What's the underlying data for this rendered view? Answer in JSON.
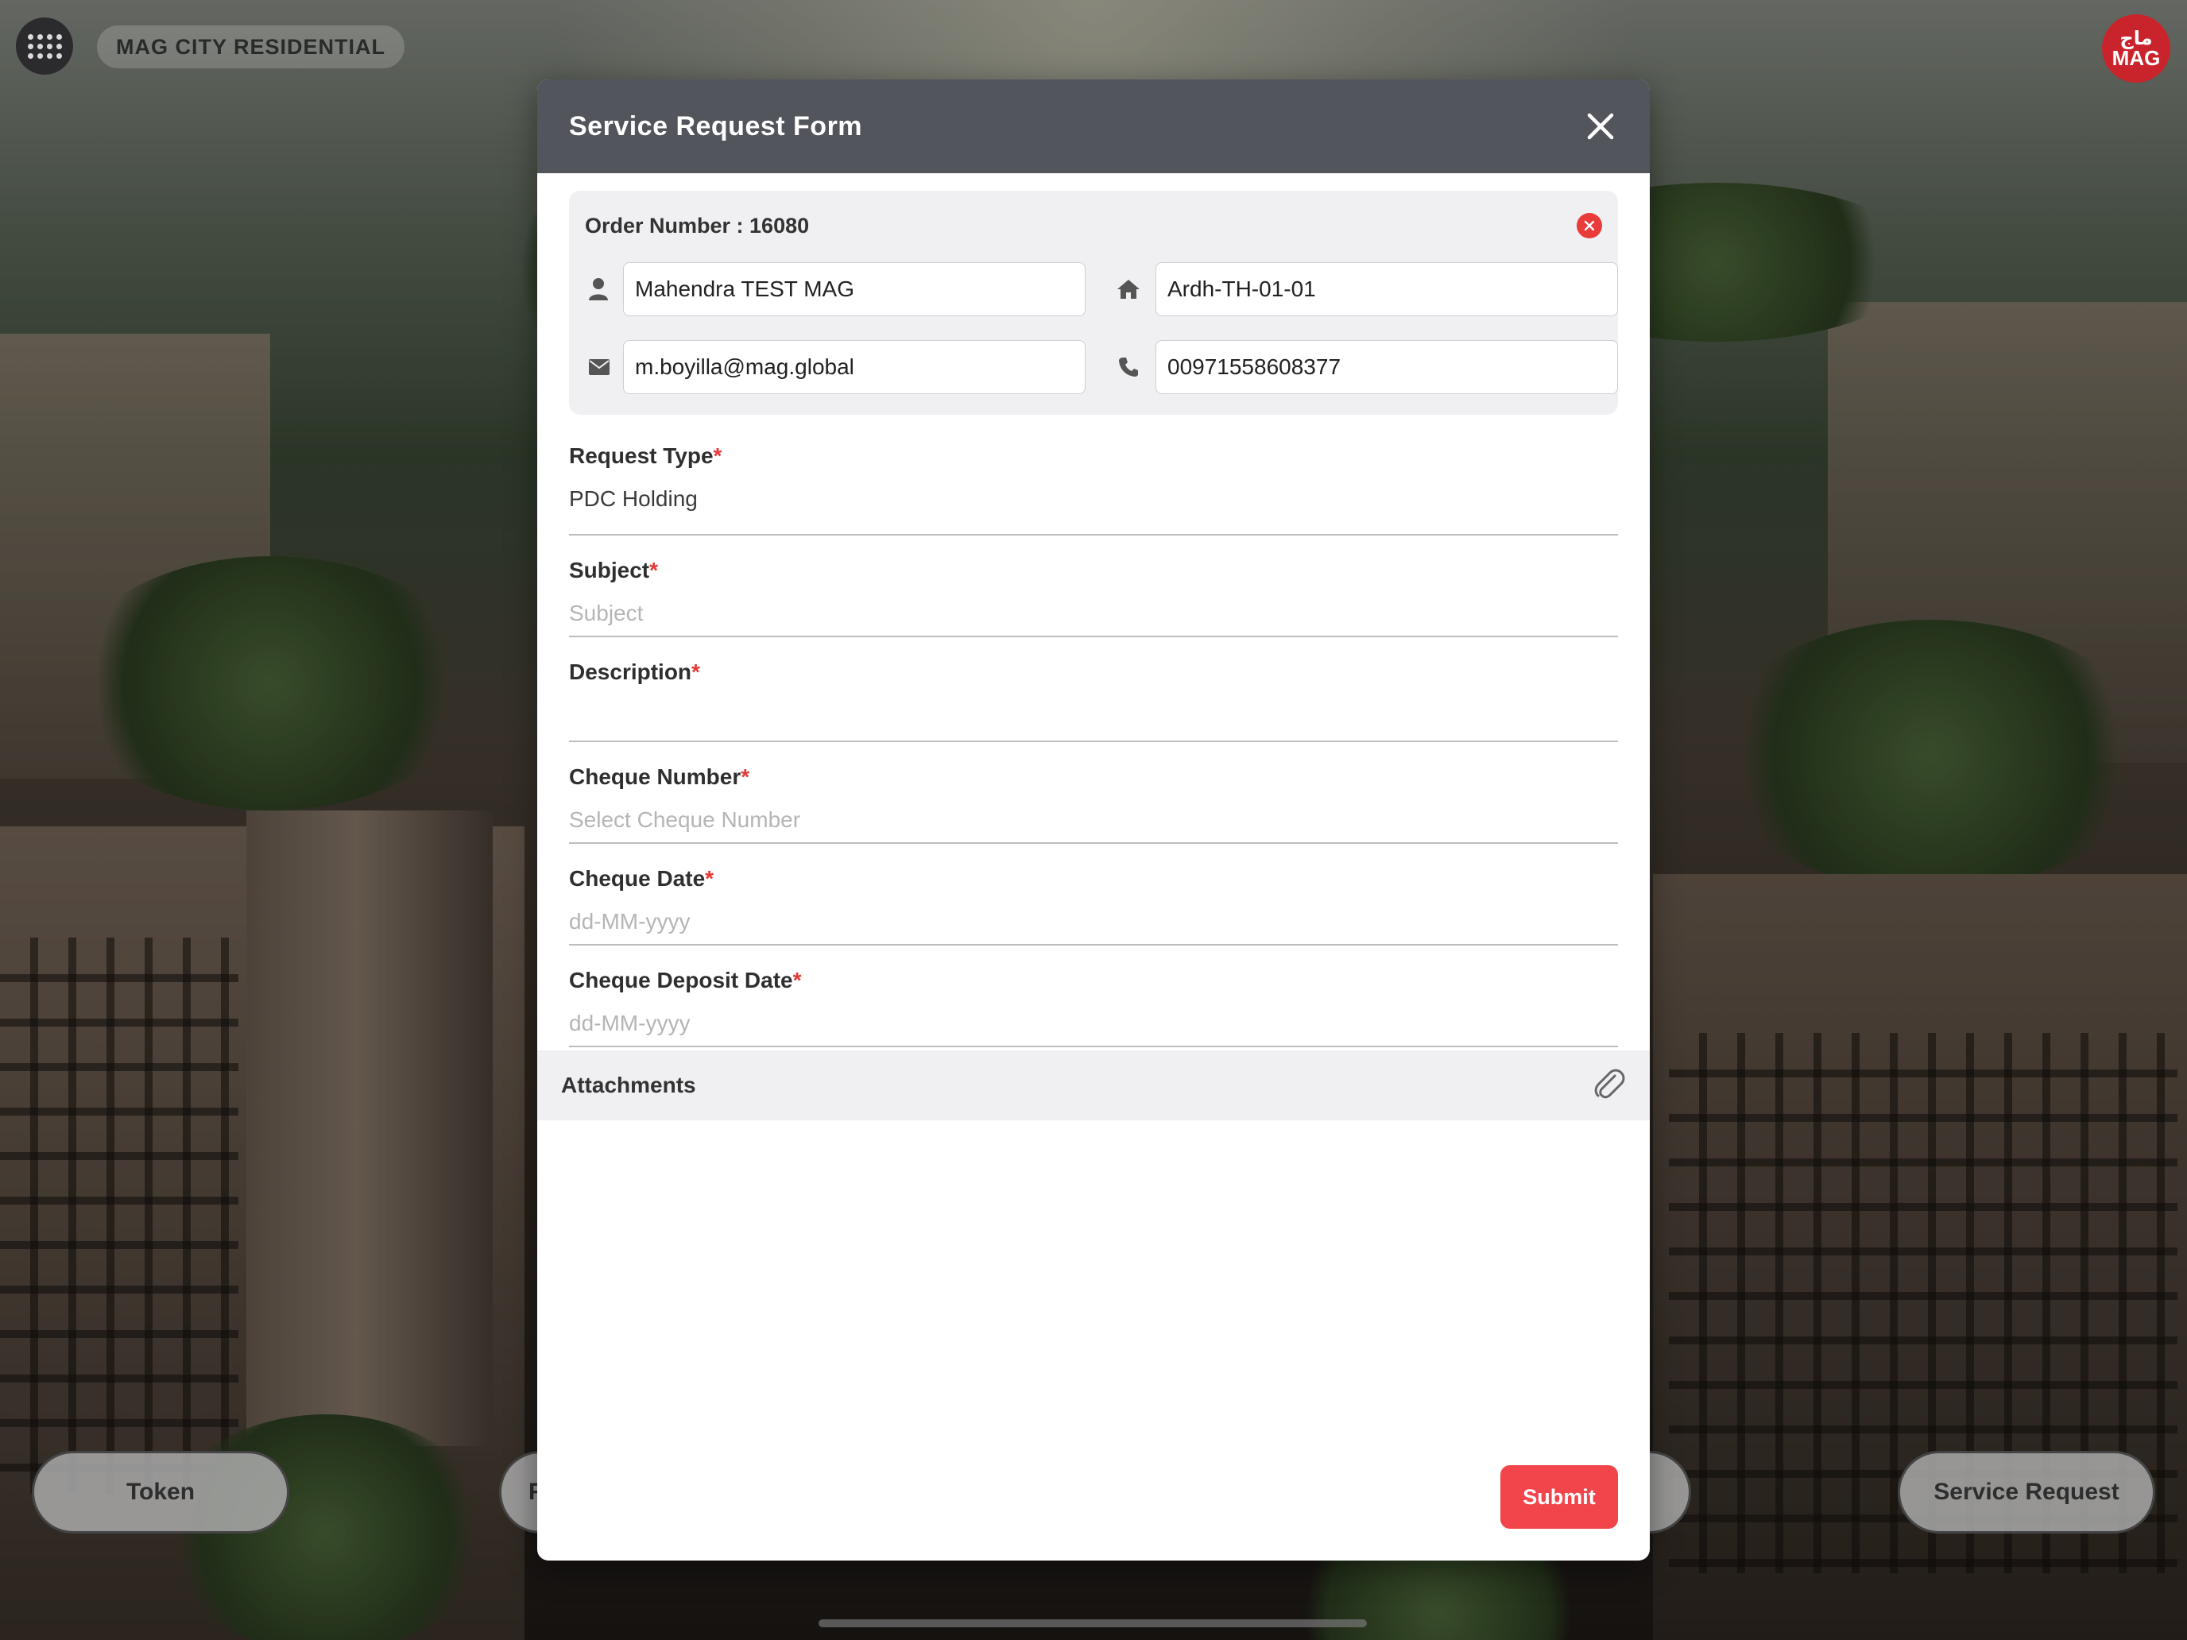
{
  "app": {
    "title": "MAG CITY RESIDENTIAL",
    "logo_arabic": "ماج",
    "logo_text": "MAG"
  },
  "bottom_nav": {
    "token_label": "Token",
    "partial_left_label": "R",
    "service_request_label": "Service Request"
  },
  "modal": {
    "title": "Service Request Form",
    "order_number_label": "Order Number : 16080",
    "customer": {
      "name": "Mahendra TEST MAG",
      "unit": "Ardh-TH-01-01",
      "email": "m.boyilla@mag.global",
      "phone": "00971558608377"
    },
    "fields": {
      "request_type": {
        "label": "Request Type",
        "required_mark": "*",
        "value": "PDC Holding"
      },
      "subject": {
        "label": "Subject",
        "required_mark": "*",
        "placeholder": "Subject"
      },
      "description": {
        "label": "Description",
        "required_mark": "*"
      },
      "cheque_number": {
        "label": "Cheque Number",
        "required_mark": "*",
        "placeholder": "Select Cheque Number"
      },
      "cheque_date": {
        "label": "Cheque Date",
        "required_mark": "*",
        "placeholder": "dd-MM-yyyy"
      },
      "cheque_deposit_date": {
        "label": "Cheque Deposit Date",
        "required_mark": "*",
        "placeholder": "dd-MM-yyyy"
      }
    },
    "attachments_label": "Attachments",
    "submit_label": "Submit"
  },
  "colors": {
    "header_bg": "#53555c",
    "accent_red": "#f2454b",
    "required_red": "#e53935",
    "logo_red": "#c9242b"
  },
  "icons": {
    "menu": "grid-dots-icon",
    "close": "close-icon",
    "cancel": "cancel-circle-icon",
    "user": "user-icon",
    "home": "home-icon",
    "email": "envelope-icon",
    "phone": "phone-icon",
    "attach": "paperclip-icon"
  }
}
